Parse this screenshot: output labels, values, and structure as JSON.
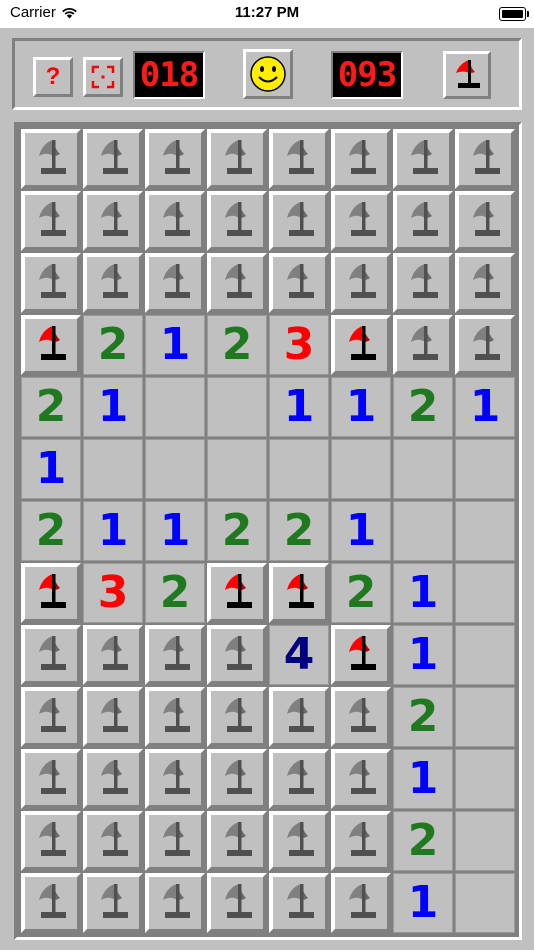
{
  "status_bar": {
    "carrier": "Carrier",
    "time": "11:27 PM"
  },
  "header": {
    "help_label": "?",
    "mine_counter": "018",
    "timer": "093"
  },
  "colors": {
    "1": "#0000ff",
    "2": "#1f7a1f",
    "3": "#ff0000",
    "4": "#000080",
    "flag_red": "#ff0000",
    "flag_gray": "#808080"
  },
  "board": {
    "rows": [
      [
        "H",
        "H",
        "H",
        "H",
        "H",
        "H",
        "H",
        "H"
      ],
      [
        "H",
        "H",
        "H",
        "H",
        "H",
        "H",
        "H",
        "H"
      ],
      [
        "H",
        "H",
        "H",
        "H",
        "H",
        "H",
        "H",
        "H"
      ],
      [
        "R",
        "2",
        "1",
        "2",
        "3",
        "R",
        "H",
        "H"
      ],
      [
        "2",
        "1",
        "0",
        "0",
        "1",
        "1",
        "2",
        "1"
      ],
      [
        "1",
        "0",
        "0",
        "0",
        "0",
        "0",
        "0",
        "0"
      ],
      [
        "2",
        "1",
        "1",
        "2",
        "2",
        "1",
        "0",
        "0"
      ],
      [
        "R",
        "3",
        "2",
        "R",
        "R",
        "2",
        "1",
        "0"
      ],
      [
        "H",
        "H",
        "H",
        "H",
        "4",
        "R",
        "1",
        "0"
      ],
      [
        "H",
        "H",
        "H",
        "H",
        "H",
        "H",
        "2",
        "0"
      ],
      [
        "H",
        "H",
        "H",
        "H",
        "H",
        "H",
        "1",
        "0"
      ],
      [
        "H",
        "H",
        "H",
        "H",
        "H",
        "H",
        "2",
        "0"
      ],
      [
        "H",
        "H",
        "H",
        "H",
        "H",
        "H",
        "1",
        "0"
      ]
    ]
  }
}
